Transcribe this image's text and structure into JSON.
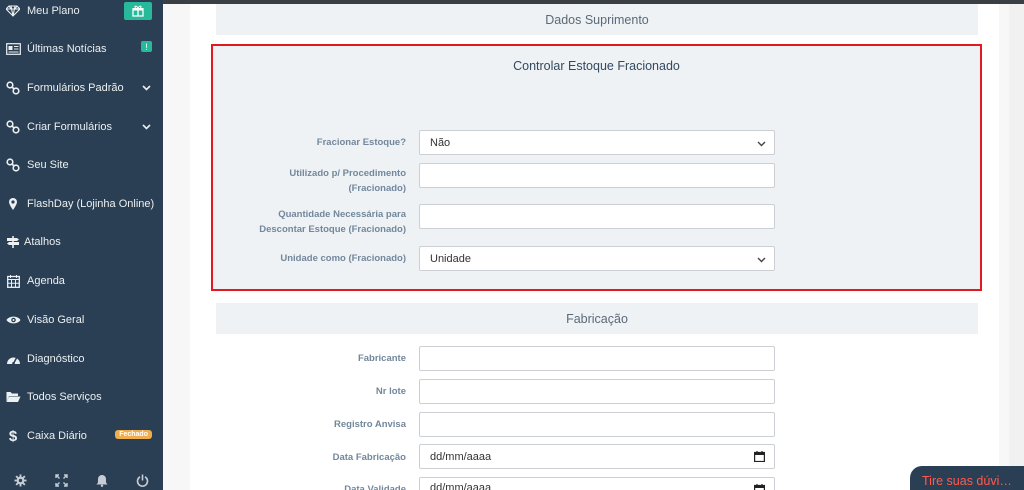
{
  "sidebar": {
    "items": [
      {
        "label": "Meu Plano",
        "icon": "diamond-icon"
      },
      {
        "label": "Últimas Notícias",
        "icon": "newspaper-icon"
      },
      {
        "label": "Formulários Padrão",
        "icon": "link-icon"
      },
      {
        "label": "Criar Formulários",
        "icon": "link-icon"
      },
      {
        "label": "Seu Site",
        "icon": "link-icon"
      },
      {
        "label": "FlashDay (Lojinha Online)",
        "icon": "map-marker-icon"
      },
      {
        "label": "Atalhos",
        "icon": "signpost-icon"
      },
      {
        "label": "Agenda",
        "icon": "calendar-icon"
      },
      {
        "label": "Visão Geral",
        "icon": "eye-icon"
      },
      {
        "label": "Diagnóstico",
        "icon": "dashboard-icon"
      },
      {
        "label": "Todos Serviços",
        "icon": "folder-open-icon"
      },
      {
        "label": "Caixa Diário",
        "icon": "dollar-icon"
      }
    ],
    "news_badge": "!",
    "caixa_badge": "Fechado"
  },
  "sections": {
    "suprimento_title": "Dados Suprimento",
    "fracionado_title": "Controlar Estoque Fracionado",
    "fabricacao_title": "Fabricação"
  },
  "fracionado_fields": {
    "fracionar_label": "Fracionar Estoque?",
    "fracionar_value": "Não",
    "procedimento_label_1": "Utilizado p/ Procedimento",
    "procedimento_label_2": "(Fracionado)",
    "quantidade_label_1": "Quantidade Necessária para",
    "quantidade_label_2": "Descontar Estoque (Fracionado)",
    "unidade_label": "Unidade como (Fracionado)",
    "unidade_value": "Unidade"
  },
  "fabricacao_fields": {
    "fabricante_label": "Fabricante",
    "lote_label": "Nr lote",
    "anvisa_label": "Registro Anvisa",
    "data_fabricacao_label": "Data Fabricação",
    "data_fabricacao_value": "dd/mm/aaaa",
    "data_validade_label": "Data Validade",
    "data_validade_value": "dd/mm/aaaa"
  },
  "chat": {
    "label": "Tire suas dúvi…"
  },
  "colors": {
    "sidebar_bg": "#2a3f54",
    "accent_green": "#26b99a",
    "highlight_red": "#e3191f",
    "badge_orange": "#f0ad4e"
  }
}
